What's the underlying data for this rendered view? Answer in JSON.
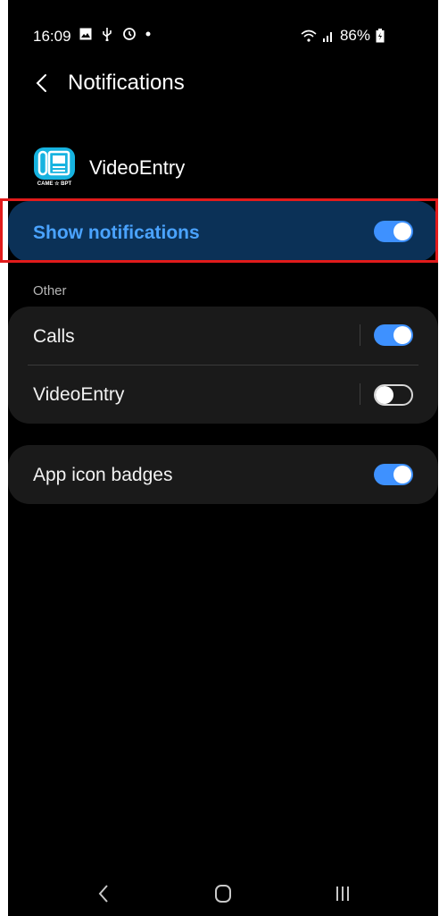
{
  "status_bar": {
    "time": "16:09",
    "battery": "86%",
    "left_icons": [
      "gallery-icon",
      "usb-icon",
      "sync-icon",
      "dot-icon"
    ],
    "right_icons": [
      "wifi-icon",
      "signal-icon",
      "battery-icon"
    ]
  },
  "header": {
    "title": "Notifications"
  },
  "app": {
    "name": "VideoEntry",
    "icon_caption": "CAME ☆ BPT"
  },
  "show_notifications": {
    "label": "Show notifications",
    "enabled": true
  },
  "categories": {
    "section_label": "Other",
    "items": [
      {
        "label": "Calls",
        "enabled": true
      },
      {
        "label": "VideoEntry",
        "enabled": false
      }
    ]
  },
  "badges": {
    "label": "App icon badges",
    "enabled": true
  },
  "colors": {
    "accent": "#3e91ff",
    "highlight_bg": "#0b3157",
    "highlight_text": "#4aa3ff",
    "annotation_border": "#e21b1b"
  },
  "nav_bar": {
    "icons": [
      "nav-back-icon",
      "nav-home-icon",
      "nav-recents-icon"
    ]
  }
}
